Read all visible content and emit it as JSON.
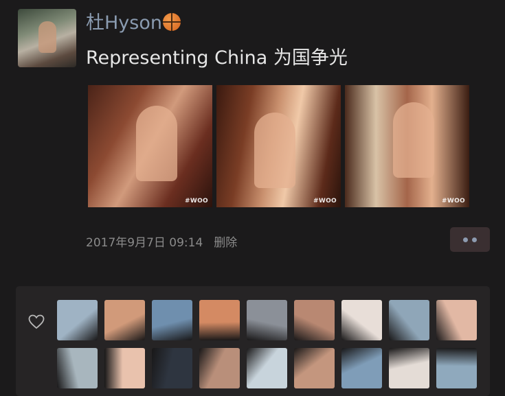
{
  "post": {
    "username": "杜Hyson",
    "username_emoji_icon": "basketball-icon",
    "text": "Representing China 为国争光",
    "media": {
      "frames": [
        {
          "watermark": "#WOO"
        },
        {
          "watermark": "#WOO"
        },
        {
          "watermark": "#WOO"
        }
      ]
    },
    "timestamp": "2017年9月7日 09:14",
    "delete_label": "删除",
    "more_icon": "more-dots-icon"
  },
  "likes": {
    "icon": "heart-icon",
    "avatars": [
      {
        "color": "#9fb3c4"
      },
      {
        "color": "#d19a7a"
      },
      {
        "color": "#6f8fae"
      },
      {
        "color": "#d48a63"
      },
      {
        "color": "#8b9098"
      },
      {
        "color": "#b98872"
      },
      {
        "color": "#e8ded8"
      },
      {
        "color": "#8fa6b8"
      },
      {
        "color": "#e2b8a4"
      },
      {
        "color": "#a8b6be"
      },
      {
        "color": "#e9c2ad"
      },
      {
        "color": "#2e3540"
      },
      {
        "color": "#b98f7a"
      },
      {
        "color": "#c8d4dc"
      },
      {
        "color": "#c4967e"
      },
      {
        "color": "#7f9db8"
      },
      {
        "color": "#e4dcd6"
      },
      {
        "color": "#8fa9bd"
      }
    ]
  },
  "colors": {
    "background": "#1b1a1b",
    "username": "#8a9bb0",
    "post_text": "#e6e6e6",
    "meta_text": "#8b8b8b",
    "more_button_bg": "#3a2f31",
    "likes_panel_bg": "#262425"
  }
}
